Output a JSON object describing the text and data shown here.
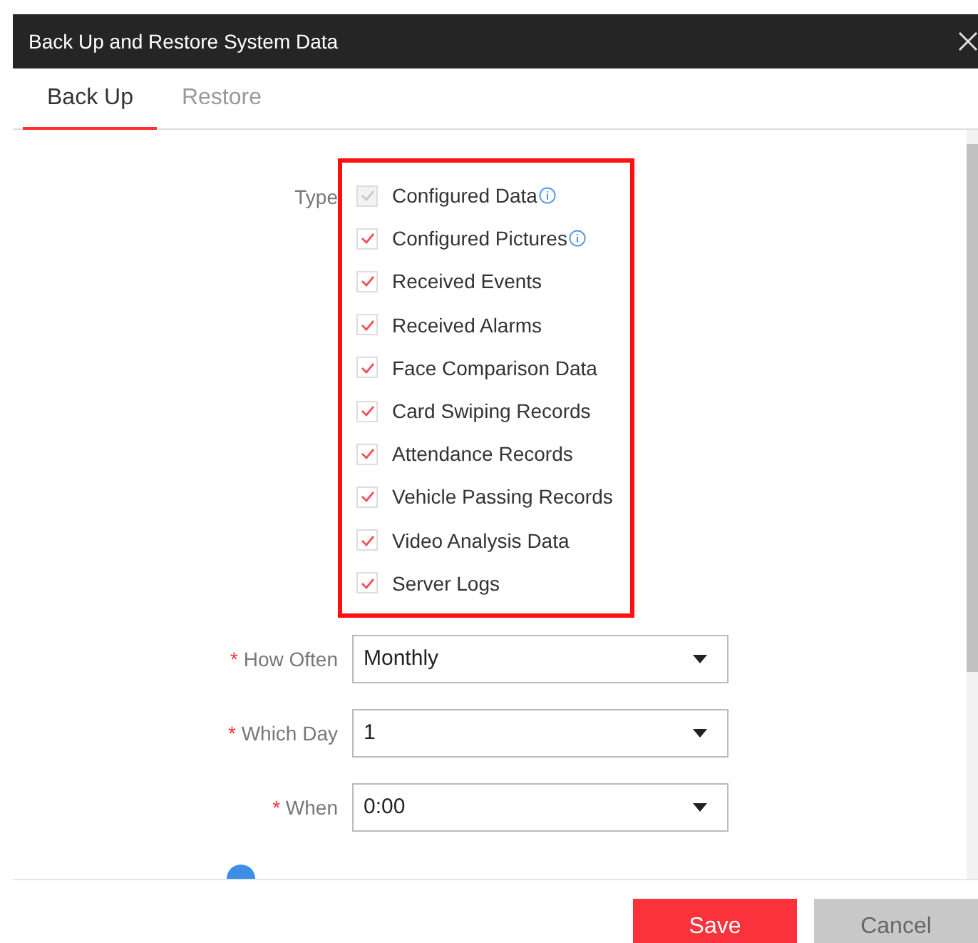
{
  "window": {
    "title": "Back Up and Restore System Data"
  },
  "tabs": [
    {
      "label": "Back Up",
      "selected": true
    },
    {
      "label": "Restore",
      "selected": false
    }
  ],
  "type_field": {
    "label": "Type",
    "highlighted": true,
    "options": [
      {
        "label": "Configured Data",
        "checked": true,
        "disabled": true,
        "info": true
      },
      {
        "label": "Configured Pictures",
        "checked": true,
        "disabled": false,
        "info": true
      },
      {
        "label": "Received Events",
        "checked": true,
        "disabled": false,
        "info": false
      },
      {
        "label": "Received Alarms",
        "checked": true,
        "disabled": false,
        "info": false
      },
      {
        "label": "Face Comparison Data",
        "checked": true,
        "disabled": false,
        "info": false
      },
      {
        "label": "Card Swiping Records",
        "checked": true,
        "disabled": false,
        "info": false
      },
      {
        "label": "Attendance Records",
        "checked": true,
        "disabled": false,
        "info": false
      },
      {
        "label": "Vehicle Passing Records",
        "checked": true,
        "disabled": false,
        "info": false
      },
      {
        "label": "Video Analysis Data",
        "checked": true,
        "disabled": false,
        "info": false
      },
      {
        "label": "Server Logs",
        "checked": true,
        "disabled": false,
        "info": false
      }
    ]
  },
  "selects": [
    {
      "label": "How Often",
      "required_mark": "*",
      "value": "Monthly"
    },
    {
      "label": "Which Day",
      "required_mark": "*",
      "value": "1"
    },
    {
      "label": "When",
      "required_mark": "*",
      "value": "0:00"
    }
  ],
  "buttons": [
    {
      "label": "Save",
      "kind": "primary"
    },
    {
      "label": "Cancel",
      "kind": "secondary"
    }
  ]
}
